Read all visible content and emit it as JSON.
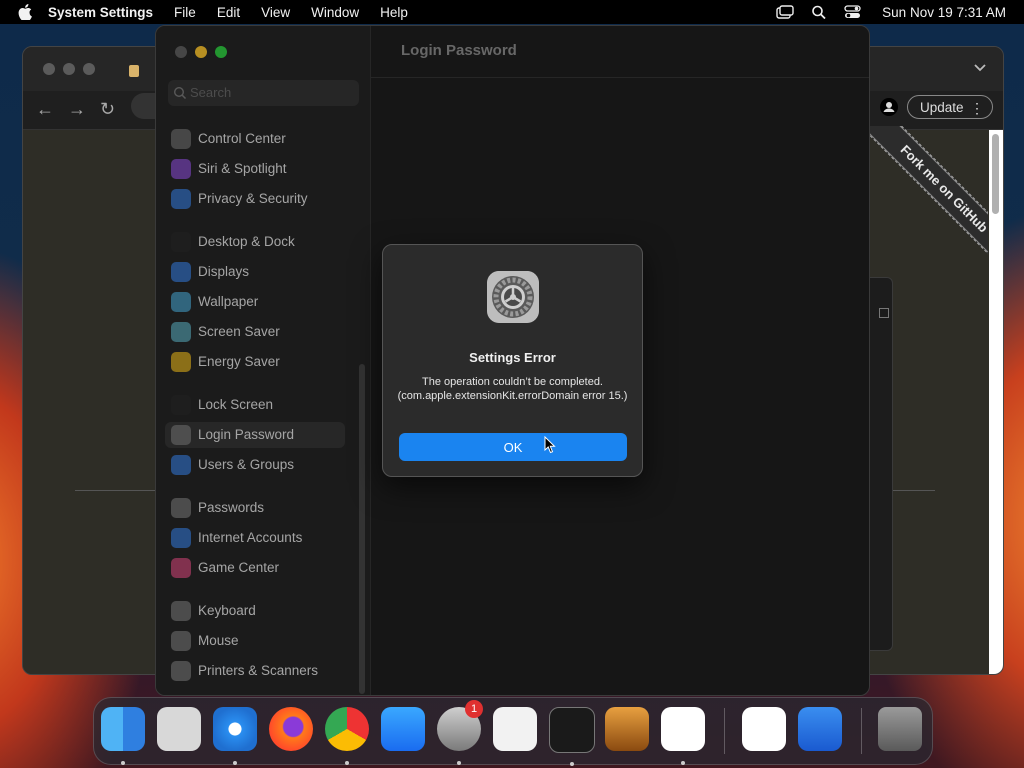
{
  "menubar": {
    "app_name": "System Settings",
    "menus": [
      "File",
      "Edit",
      "View",
      "Window",
      "Help"
    ],
    "clock": "Sun Nov 19  7:31 AM"
  },
  "browser": {
    "update_label": "Update",
    "menu_dots": "⋮",
    "ribbon_text": "Fork me on GitHub",
    "back_icon": "←",
    "forward_icon": "→",
    "reload_icon": "↻"
  },
  "settings": {
    "search_placeholder": "Search",
    "page_title": "Login Password",
    "sidebar": [
      {
        "label": "Control Center",
        "color": "#6e6e6e"
      },
      {
        "label": "Siri & Spotlight",
        "color": "#8a4fd0"
      },
      {
        "label": "Privacy & Security",
        "color": "#3a7bd5"
      },
      {
        "label": "Desktop & Dock",
        "color": "#2a2a2a"
      },
      {
        "label": "Displays",
        "color": "#3a7bd5"
      },
      {
        "label": "Wallpaper",
        "color": "#4aa0c8"
      },
      {
        "label": "Screen Saver",
        "color": "#5aa8b8"
      },
      {
        "label": "Energy Saver",
        "color": "#e0b020"
      },
      {
        "label": "Lock Screen",
        "color": "#2a2a2a"
      },
      {
        "label": "Login Password",
        "color": "#777777"
      },
      {
        "label": "Users & Groups",
        "color": "#3a7bd5"
      },
      {
        "label": "Passwords",
        "color": "#777777"
      },
      {
        "label": "Internet Accounts",
        "color": "#3a7bd5"
      },
      {
        "label": "Game Center",
        "color": "#d04a7a"
      },
      {
        "label": "Keyboard",
        "color": "#777777"
      },
      {
        "label": "Mouse",
        "color": "#777777"
      },
      {
        "label": "Printers & Scanners",
        "color": "#777777"
      }
    ]
  },
  "dialog": {
    "title": "Settings Error",
    "message": "The operation couldn’t be completed. (com.apple.extensionKit.errorDomain error 15.)",
    "ok_label": "OK"
  },
  "dock": {
    "settings_badge": "1",
    "apps": [
      "finder",
      "launchpad",
      "safari",
      "firefox",
      "chrome",
      "app-store",
      "system-settings",
      "textedit",
      "terminal",
      "garageband",
      "vscode",
      "visual-studio",
      "weather",
      "trash"
    ]
  }
}
